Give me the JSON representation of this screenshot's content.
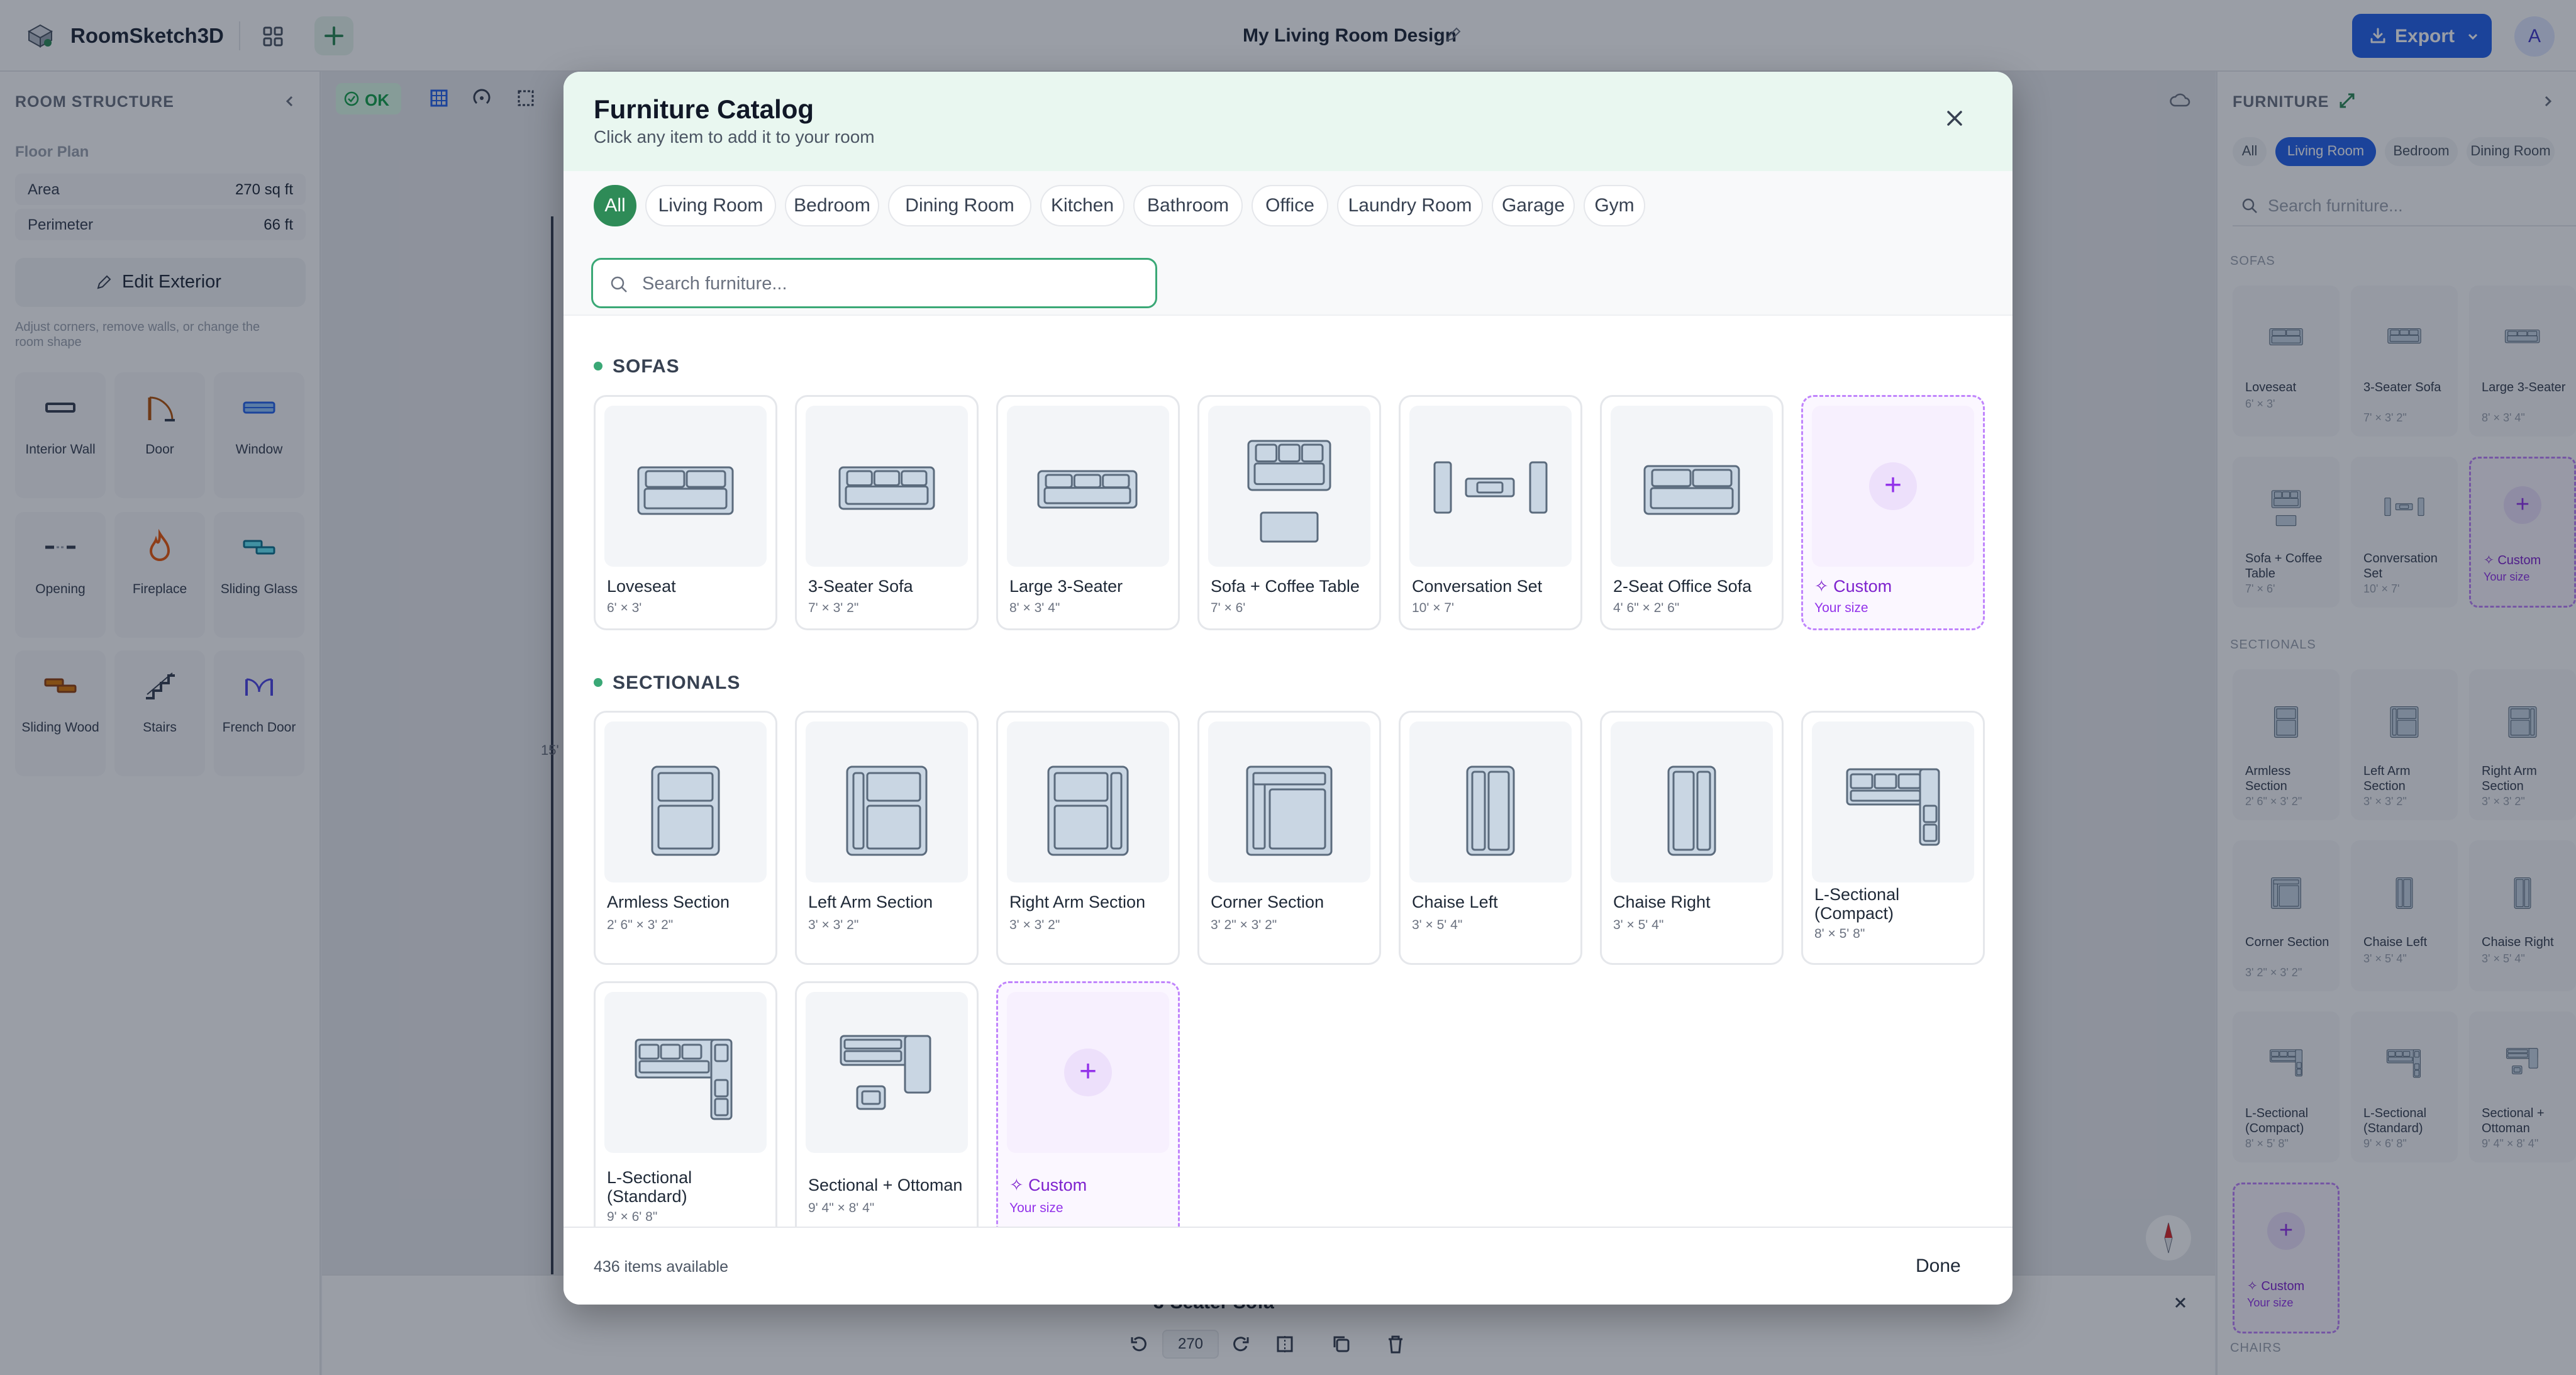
{
  "app": {
    "name": "RoomSketch3D",
    "design_title": "My Living Room Design",
    "export_label": "Export",
    "avatar_initial": "A"
  },
  "left_panel": {
    "title": "ROOM STRUCTURE",
    "floor_plan_label": "Floor Plan",
    "area_label": "Area",
    "area_value": "270 sq ft",
    "perimeter_label": "Perimeter",
    "perimeter_value": "66 ft",
    "edit_exterior_label": "Edit Exterior",
    "edit_hint": "Adjust corners, remove walls, or change the room shape",
    "tools": [
      {
        "label": "Interior Wall",
        "icon": "wall-icon"
      },
      {
        "label": "Door",
        "icon": "door-icon"
      },
      {
        "label": "Window",
        "icon": "window-icon"
      },
      {
        "label": "Opening",
        "icon": "opening-icon"
      },
      {
        "label": "Fireplace",
        "icon": "fireplace-icon"
      },
      {
        "label": "Sliding Glass",
        "icon": "sliding-glass-icon"
      },
      {
        "label": "Sliding Wood",
        "icon": "sliding-wood-icon"
      },
      {
        "label": "Stairs",
        "icon": "stairs-icon"
      },
      {
        "label": "French Door",
        "icon": "french-door-icon"
      }
    ]
  },
  "toolbar": {
    "status": "OK"
  },
  "canvas": {
    "ruler_label": "15'",
    "selected_item": "3-Seater Sofa",
    "rotation_value": "270"
  },
  "right_panel": {
    "title": "FURNITURE",
    "tabs": [
      "All",
      "Living Room",
      "Bedroom",
      "Dining Room"
    ],
    "active_tab": "Living Room",
    "search_placeholder": "Search furniture...",
    "sofas_title": "SOFAS",
    "sofas": [
      {
        "name": "Loveseat",
        "dims": "6' × 3'"
      },
      {
        "name": "3-Seater Sofa",
        "dims": "7' × 3' 2\""
      },
      {
        "name": "Large 3-Seater",
        "dims": "8' × 3' 4\""
      },
      {
        "name": "Sofa + Coffee Table",
        "dims": "7' × 6'"
      },
      {
        "name": "Conversation Set",
        "dims": "10' × 7'"
      },
      {
        "name": "Custom",
        "dims": "Your size"
      }
    ],
    "sectionals_title": "SECTIONALS",
    "sectionals": [
      {
        "name": "Armless Section",
        "dims": "2' 6\" × 3' 2\""
      },
      {
        "name": "Left Arm Section",
        "dims": "3' × 3' 2\""
      },
      {
        "name": "Right Arm Section",
        "dims": "3' × 3' 2\""
      },
      {
        "name": "Corner Section",
        "dims": "3' 2\" × 3' 2\""
      },
      {
        "name": "Chaise Left",
        "dims": "3' × 5' 4\""
      },
      {
        "name": "Chaise Right",
        "dims": "3' × 5' 4\""
      },
      {
        "name": "L-Sectional (Compact)",
        "dims": "8' × 5' 8\""
      },
      {
        "name": "L-Sectional (Standard)",
        "dims": "9' × 6' 8\""
      },
      {
        "name": "Sectional + Ottoman",
        "dims": "9' 4\" × 8' 4\""
      },
      {
        "name": "Custom",
        "dims": "Your size"
      }
    ],
    "chairs_title": "CHAIRS"
  },
  "modal": {
    "title": "Furniture Catalog",
    "subtitle": "Click any item to add it to your room",
    "categories": [
      "All",
      "Living Room",
      "Bedroom",
      "Dining Room",
      "Kitchen",
      "Bathroom",
      "Office",
      "Laundry Room",
      "Garage",
      "Gym"
    ],
    "active_category": "All",
    "search_placeholder": "Search furniture...",
    "sections": [
      {
        "title": "SOFAS",
        "items": [
          {
            "name": "Loveseat",
            "dims": "6' × 3'"
          },
          {
            "name": "3-Seater Sofa",
            "dims": "7' × 3' 2\""
          },
          {
            "name": "Large 3-Seater",
            "dims": "8' × 3' 4\""
          },
          {
            "name": "Sofa + Coffee Table",
            "dims": "7' × 6'"
          },
          {
            "name": "Conversation Set",
            "dims": "10' × 7'"
          },
          {
            "name": "2-Seat Office Sofa",
            "dims": "4' 6\" × 2' 6\""
          },
          {
            "name": "Custom",
            "dims": "Your size"
          }
        ]
      },
      {
        "title": "SECTIONALS",
        "items": [
          {
            "name": "Armless Section",
            "dims": "2' 6\" × 3' 2\""
          },
          {
            "name": "Left Arm Section",
            "dims": "3' × 3' 2\""
          },
          {
            "name": "Right Arm Section",
            "dims": "3' × 3' 2\""
          },
          {
            "name": "Corner Section",
            "dims": "3' 2\" × 3' 2\""
          },
          {
            "name": "Chaise Left",
            "dims": "3' × 5' 4\""
          },
          {
            "name": "Chaise Right",
            "dims": "3' × 5' 4\""
          },
          {
            "name": "L-Sectional (Compact)",
            "dims": "8' × 5' 8\""
          },
          {
            "name": "L-Sectional (Standard)",
            "dims": "9' × 6' 8\""
          },
          {
            "name": "Sectional + Ottoman",
            "dims": "9' 4\" × 8' 4\""
          },
          {
            "name": "Custom",
            "dims": "Your size"
          }
        ]
      }
    ],
    "items_available": "436 items available",
    "done_label": "Done"
  },
  "colors": {
    "accent_green": "#2e8b57",
    "export_blue": "#2563eb",
    "custom_purple": "#9333ea",
    "furniture_fill": "#c9d6e3",
    "furniture_stroke": "#5b6b7d"
  }
}
